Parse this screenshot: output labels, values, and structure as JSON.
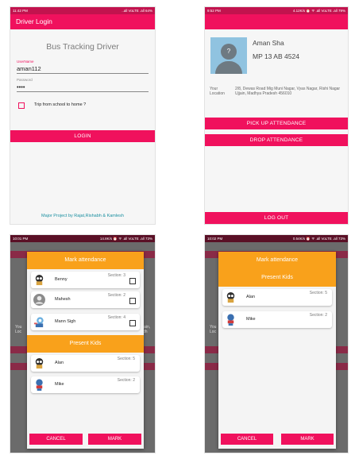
{
  "login": {
    "status_time": "11:42 PM",
    "status_icons": "..all VoLTE .all 64%",
    "appbar_title": "Driver Login",
    "heading": "Bus Tracking Driver",
    "username_label": "UserName",
    "username_value": "aman112",
    "password_label": "Password",
    "password_value": "••••",
    "checkbox_label": "Trip from school to home ?",
    "login_button": "LOGIN",
    "footer": "Major Project by Rajat,Rishabh & Kamlesh"
  },
  "profile": {
    "status_time": "9:52 PM",
    "status_icons": "4.12K/s ⏰ ᯤ .all VoLTE .all 79%",
    "name": "Aman Sha",
    "bus_number": "MP 13 AB 4524",
    "location_label": "Your Location",
    "address": "2/8, Dewas Road Mig Muni Nagar, Vyas Nagar, Rishi Nagar Ujjain, Madhya Pradesh 456010",
    "pickup_button": "PICK UP ATTENDANCE",
    "drop_button": "DROP ATTENDANCE",
    "logout_button": "LOG OUT"
  },
  "mark_dialog": {
    "status_time": "10:01 PM",
    "status_icons": "14.8K/s ⏰ ᯤ .all VoLTE .all 73%",
    "header": "Mark attendance",
    "unmarked_kids": [
      {
        "name": "Benny",
        "section": "Section: 3",
        "icon": "cartoon-kid-icon"
      },
      {
        "name": "Mahesh",
        "section": "Section: 2",
        "icon": "default-avatar-icon"
      },
      {
        "name": "Mann Sigh",
        "section": "Section: 4",
        "icon": "cartoon-kid-icon"
      }
    ],
    "present_header": "Present Kids",
    "present_kids": [
      {
        "name": "Alan",
        "section": "Section: 5",
        "icon": "cartoon-kid-icon"
      },
      {
        "name": "Mike",
        "section": "Section: 2",
        "icon": "cartoon-kid-icon"
      }
    ],
    "cancel_button": "CANCEL",
    "mark_button": "MARK",
    "background_text": "You Loc",
    "background_text_right": "jain, dh"
  },
  "present_dialog": {
    "status_time": "10:02 PM",
    "status_icons": "0.54K/s ⏰ ᯤ .all VoLTE .all 73%",
    "header": "Mark attendance",
    "present_header": "Present Kids",
    "present_kids": [
      {
        "name": "Alan",
        "section": "Section: 5",
        "icon": "cartoon-kid-icon"
      },
      {
        "name": "Mike",
        "section": "Section: 2",
        "icon": "cartoon-kid-icon"
      }
    ],
    "cancel_button": "CANCEL",
    "mark_button": "MARK",
    "background_text": "You Loc"
  },
  "colors": {
    "primary": "#f0115d",
    "status_bar": "#c2134e",
    "dialog_header": "#f9a11b",
    "footer_link": "#1a8fa0"
  }
}
